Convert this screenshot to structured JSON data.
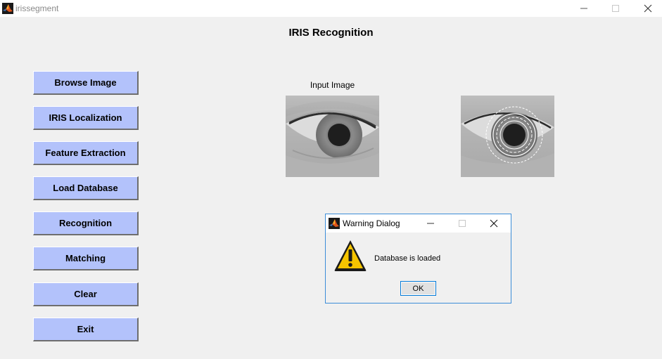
{
  "window": {
    "title": "irissegment",
    "icon": "matlab-icon"
  },
  "page": {
    "title": "IRIS Recognition"
  },
  "buttons": {
    "browse": "Browse Image",
    "localization": "IRIS Localization",
    "feature": "Feature Extraction",
    "load_db": "Load Database",
    "recognition": "Recognition",
    "matching": "Matching",
    "clear": "Clear",
    "exit": "Exit",
    "color": "#b3c2fb"
  },
  "images": {
    "input_label": "Input Image"
  },
  "dialog": {
    "title": "Warning Dialog",
    "message": "Database is loaded",
    "ok_label": "OK",
    "icon": "warning-icon"
  }
}
